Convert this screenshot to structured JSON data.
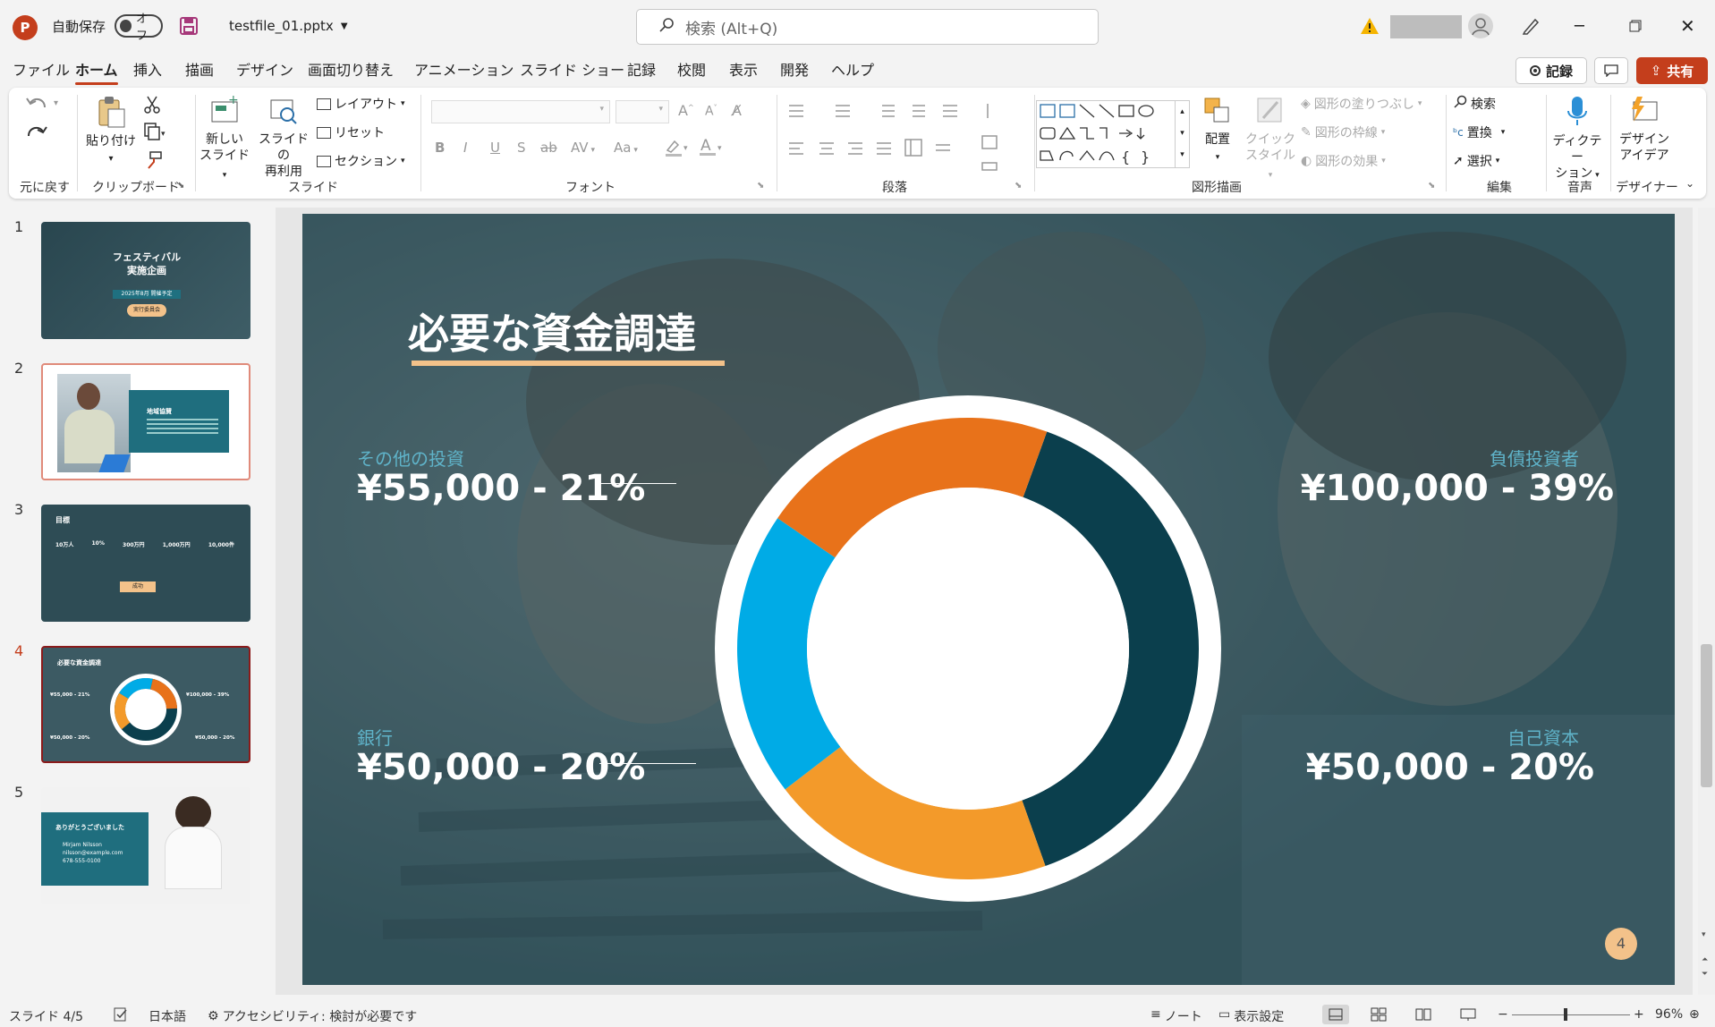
{
  "titlebar": {
    "app_badge": "P",
    "autosave_label": "自動保存",
    "autosave_state": "オフ",
    "filename": "testfile_01.pptx",
    "search_placeholder": "検索 (Alt+Q)"
  },
  "menu": {
    "tabs": [
      "ファイル",
      "ホーム",
      "挿入",
      "描画",
      "デザイン",
      "画面切り替え",
      "アニメーション",
      "スライド ショー",
      "記録",
      "校閲",
      "表示",
      "開発",
      "ヘルプ"
    ],
    "active_tab": "ホーム",
    "record_label": "記録",
    "share_label": "共有"
  },
  "ribbon": {
    "groups": {
      "undo": "元に戻す",
      "clipboard": "クリップボード",
      "slides": "スライド",
      "font": "フォント",
      "paragraph": "段落",
      "drawing": "図形描画",
      "editing": "編集",
      "voice": "音声",
      "designer": "デザイナー"
    },
    "paste": [
      "貼り付け"
    ],
    "new_slide": [
      "新しい",
      "スライド"
    ],
    "reuse_slide": [
      "スライドの",
      "再利用"
    ],
    "layout": "レイアウト",
    "reset": "リセット",
    "section": "セクション",
    "arrange": "配置",
    "quick_style": [
      "クイック",
      "スタイル"
    ],
    "shape_fill": "図形の塗りつぶし",
    "shape_outline": "図形の枠線",
    "shape_effects": "図形の効果",
    "find": "検索",
    "replace": "置換",
    "select": "選択",
    "dictate": [
      "ディクテー",
      "ション"
    ],
    "design_ideas": [
      "デザイン",
      "アイデア"
    ],
    "font_glyphs": {
      "bold": "B",
      "italic": "I",
      "underline": "U",
      "shadow": "S",
      "strike": "ab",
      "spacing": "AV",
      "case": "Aa"
    }
  },
  "thumbnails": [
    {
      "num": "1",
      "title": "フェスティバル",
      "subtitle": "実施企画",
      "line": "2025年8月 開催予定",
      "pill": "実行委員会"
    },
    {
      "num": "2",
      "title": "地域協賛"
    },
    {
      "num": "3",
      "title": "目標",
      "cols": [
        "10万人",
        "10%",
        "300万円",
        "1,000万円",
        "10,000件"
      ],
      "pill": "成功"
    },
    {
      "num": "4",
      "title": "必要な資金調達",
      "l1": "¥55,000 - 21%",
      "l2": "¥50,000 - 20%",
      "r1": "¥100,000 - 39%",
      "r2": "¥50,000 - 20%"
    },
    {
      "num": "5",
      "title": "ありがとうございました",
      "lines": [
        "Mirjam Nilsson",
        "nilsson@example.com",
        "678-555-0100"
      ]
    }
  ],
  "selected_thumbnail": "4",
  "slide": {
    "title": "必要な資金調達",
    "page_number": "4",
    "labels": [
      {
        "category": "その他の投資",
        "value": "¥55,000 - 21%"
      },
      {
        "category": "負債投資者",
        "value": "¥100,000 - 39%"
      },
      {
        "category": "銀行",
        "value": "¥50,000 - 20%"
      },
      {
        "category": "自己資本",
        "value": "¥50,000 - 20%"
      }
    ]
  },
  "chart_data": {
    "type": "pie",
    "categories": [
      "負債投資者",
      "自己資本",
      "銀行",
      "その他の投資"
    ],
    "values": [
      39,
      20,
      20,
      21
    ],
    "colors": [
      "#0b3f4d",
      "#f39a2a",
      "#00abe6",
      "#e8721a"
    ]
  },
  "statusbar": {
    "slide_info": "スライド 4/5",
    "language": "日本語",
    "accessibility": "アクセシビリティ: 検討が必要です",
    "notes": "ノート",
    "display_settings": "表示設定",
    "zoom": "96%"
  }
}
